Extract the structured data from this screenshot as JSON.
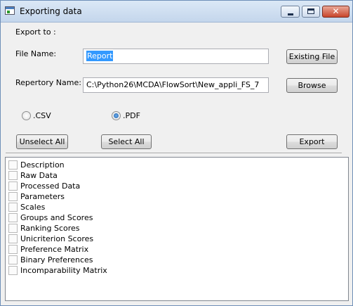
{
  "window": {
    "title": "Exporting data"
  },
  "form": {
    "export_to_label": "Export to :",
    "file_name_label": "File Name:",
    "file_name_value": "Report",
    "repertory_label": "Repertory Name:",
    "repertory_value": "C:\\Python26\\MCDA\\FlowSort\\New_appli_FS_7",
    "existing_file_button": "Existing File",
    "browse_button": "Browse"
  },
  "format": {
    "options": [
      {
        "label": ".CSV",
        "checked": false
      },
      {
        "label": ".PDF",
        "checked": true
      }
    ]
  },
  "actions": {
    "unselect_all": "Unselect All",
    "select_all": "Select All",
    "export": "Export"
  },
  "items": [
    {
      "label": "Description",
      "checked": false
    },
    {
      "label": "Raw Data",
      "checked": false
    },
    {
      "label": "Processed Data",
      "checked": false
    },
    {
      "label": "Parameters",
      "checked": false
    },
    {
      "label": "Scales",
      "checked": false
    },
    {
      "label": "Groups and Scores",
      "checked": false
    },
    {
      "label": "Ranking Scores",
      "checked": false
    },
    {
      "label": "Unicriterion Scores",
      "checked": false
    },
    {
      "label": "Preference Matrix",
      "checked": false
    },
    {
      "label": "Binary Preferences",
      "checked": false
    },
    {
      "label": "Incomparability Matrix",
      "checked": false
    }
  ]
}
